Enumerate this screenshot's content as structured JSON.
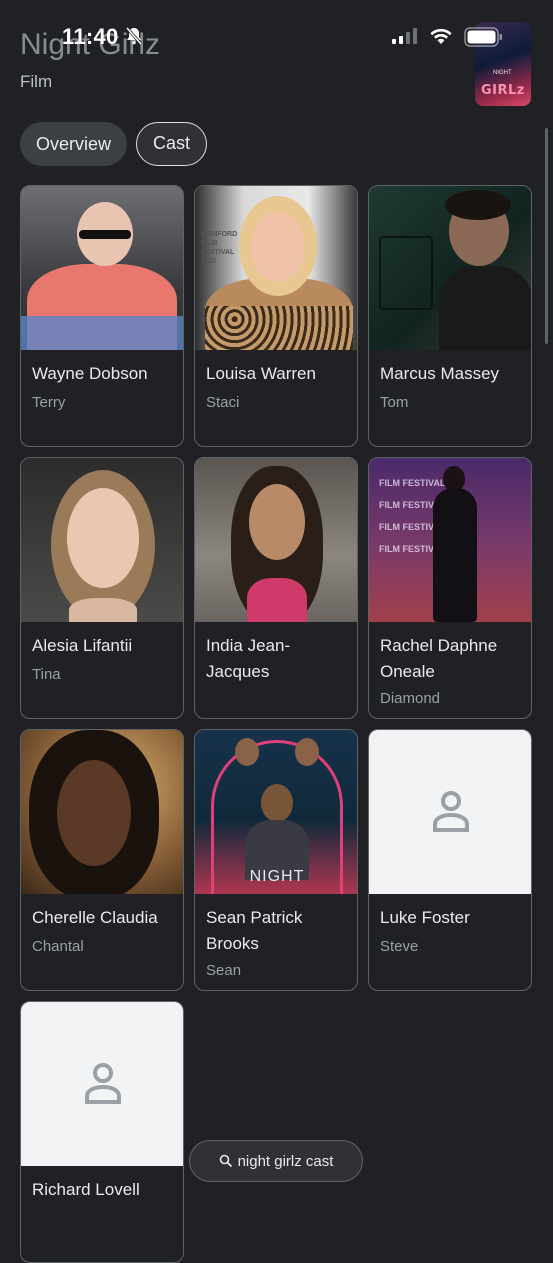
{
  "status_bar": {
    "time": "11:40"
  },
  "header": {
    "title": "Night Girlz",
    "subtitle": "Film",
    "poster_text": "GIRLz",
    "poster_small": "NIGHT"
  },
  "tabs": [
    {
      "label": "Overview",
      "selected": false
    },
    {
      "label": "Cast",
      "selected": true
    }
  ],
  "cast": [
    {
      "name": "Wayne Dobson",
      "role": "Terry"
    },
    {
      "name": "Louisa Warren",
      "role": "Staci"
    },
    {
      "name": "Marcus Massey",
      "role": "Tom"
    },
    {
      "name": "Alesia Lifantii",
      "role": "Tina"
    },
    {
      "name": "India Jean-Jacques",
      "role": ""
    },
    {
      "name": "Rachel Daphne Oneale",
      "role": "Diamond"
    },
    {
      "name": "Cherelle Claudia",
      "role": "Chantal"
    },
    {
      "name": "Sean Patrick Brooks",
      "role": "Sean"
    },
    {
      "name": "Luke Foster",
      "role": "Steve"
    },
    {
      "name": "Richard Lovell",
      "role": ""
    }
  ],
  "photo_text": {
    "louisa_sign": "ROMFORD FILM FESTIVAL 2021",
    "sean_poster": "NIGHT",
    "rachel_backdrop": "FILM FESTIVAL"
  },
  "search": {
    "query": "night girlz cast",
    "icon": "search-icon"
  }
}
